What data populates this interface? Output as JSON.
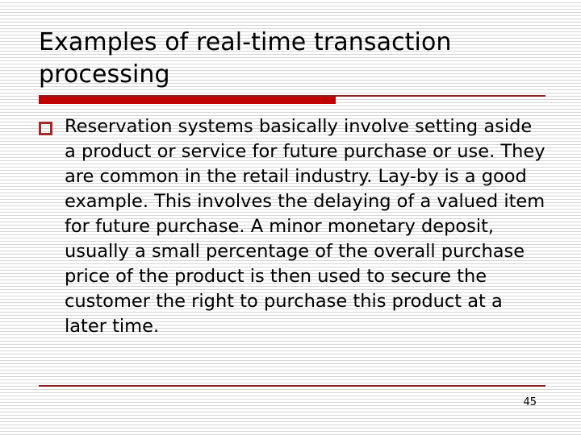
{
  "slide": {
    "title": "Examples of real-time transaction processing",
    "bullets": [
      {
        "marker": "hollow-square-bullet",
        "text": "Reservation systems basically involve setting aside a product or service for future purchase or use. They are common in the retail industry. Lay-by is a good example. This involves the delaying of a valued item for future purchase. A minor monetary deposit, usually a small percentage of the overall purchase price of the product is then used to secure the customer the right to purchase this product at a later time."
      }
    ],
    "page_number": "45",
    "colors": {
      "accent_bar": "#c00000",
      "accent_rule": "#8b2020",
      "bullet_marker": "#9e2a2a",
      "text": "#000000",
      "background": "#ffffff",
      "background_stripe": "#d6d6d6"
    }
  }
}
